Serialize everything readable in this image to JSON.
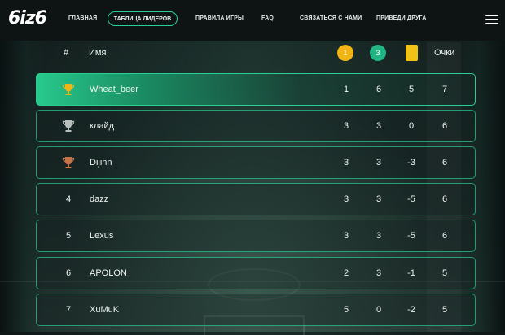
{
  "header": {
    "logo": "6iz6",
    "nav": [
      "ГЛАВНАЯ",
      "ТАБЛИЦА ЛИДЕРОВ",
      "ПРАВИЛА ИГРЫ",
      "FAQ",
      "СВЯЗАТЬСЯ С НАМИ",
      "ПРИВЕДИ ДРУГА"
    ],
    "active_index": 1
  },
  "table": {
    "columns": {
      "rank": "#",
      "name": "Имя",
      "gold_badge": "1",
      "green_badge": "3",
      "card_icon": "yellow-card-icon",
      "points": "Очки"
    },
    "rows": [
      {
        "rank": "",
        "trophy": "gold",
        "name": "Wheat_beer",
        "a": "1",
        "b": "6",
        "c": "5",
        "pts": "7"
      },
      {
        "rank": "",
        "trophy": "silver",
        "name": "клайд",
        "a": "3",
        "b": "3",
        "c": "0",
        "pts": "6"
      },
      {
        "rank": "",
        "trophy": "bronze",
        "name": "Dijinn",
        "a": "3",
        "b": "3",
        "c": "-3",
        "pts": "6"
      },
      {
        "rank": "4",
        "trophy": "",
        "name": "dazz",
        "a": "3",
        "b": "3",
        "c": "-5",
        "pts": "6"
      },
      {
        "rank": "5",
        "trophy": "",
        "name": "Lexus",
        "a": "3",
        "b": "3",
        "c": "-5",
        "pts": "6"
      },
      {
        "rank": "6",
        "trophy": "",
        "name": "APOLON",
        "a": "2",
        "b": "3",
        "c": "-1",
        "pts": "5"
      },
      {
        "rank": "7",
        "trophy": "",
        "name": "XuMuK",
        "a": "5",
        "b": "0",
        "c": "-2",
        "pts": "5"
      }
    ]
  },
  "colors": {
    "accent": "#2ad093",
    "gold": "#f2b516",
    "silver": "#b9bfbd",
    "bronze": "#c7744a",
    "badge_green": "#20b582"
  }
}
